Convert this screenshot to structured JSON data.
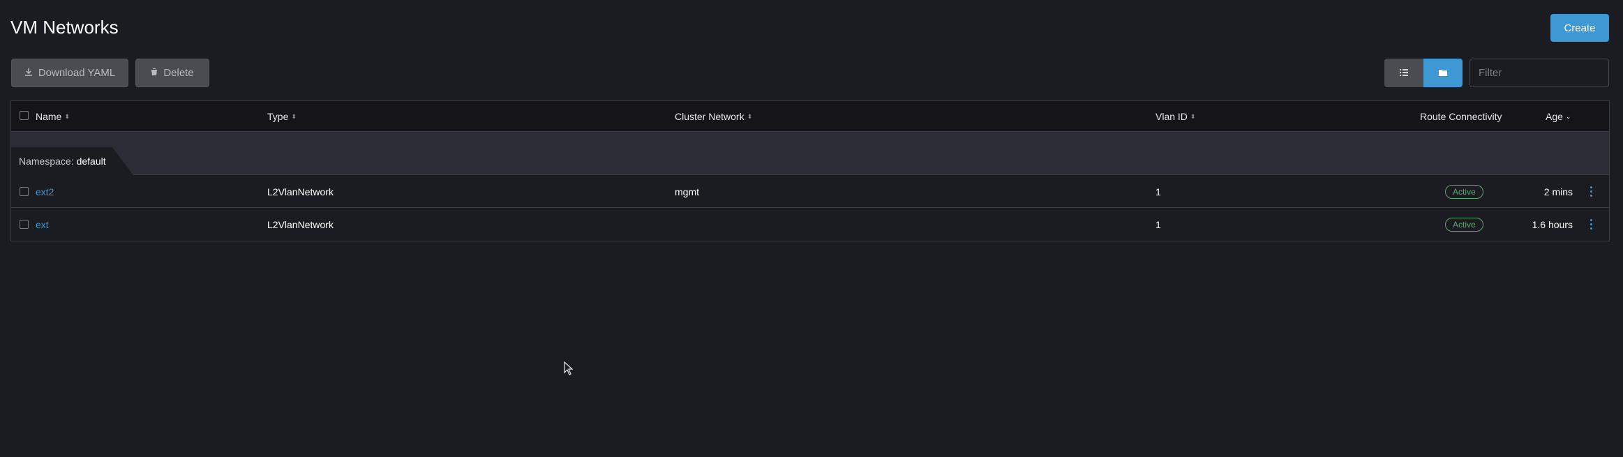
{
  "header": {
    "title": "VM Networks",
    "create_label": "Create"
  },
  "toolbar": {
    "download_label": "Download YAML",
    "delete_label": "Delete",
    "filter_placeholder": "Filter",
    "view_mode": "group-by-namespace"
  },
  "table": {
    "columns": {
      "name": "Name",
      "type": "Type",
      "cluster_network": "Cluster Network",
      "vlan_id": "Vlan ID",
      "route_connectivity": "Route Connectivity",
      "age": "Age"
    },
    "group": {
      "label": "Namespace:",
      "value": "default"
    },
    "rows": [
      {
        "name": "ext2",
        "type": "L2VlanNetwork",
        "cluster_network": "mgmt",
        "vlan_id": "1",
        "route_connectivity": "Active",
        "age": "2 mins"
      },
      {
        "name": "ext",
        "type": "L2VlanNetwork",
        "cluster_network": "",
        "vlan_id": "1",
        "route_connectivity": "Active",
        "age": "1.6 hours"
      }
    ]
  },
  "colors": {
    "background": "#1b1c21",
    "accent": "#3d98d3",
    "active_badge": "#5ea76a"
  }
}
